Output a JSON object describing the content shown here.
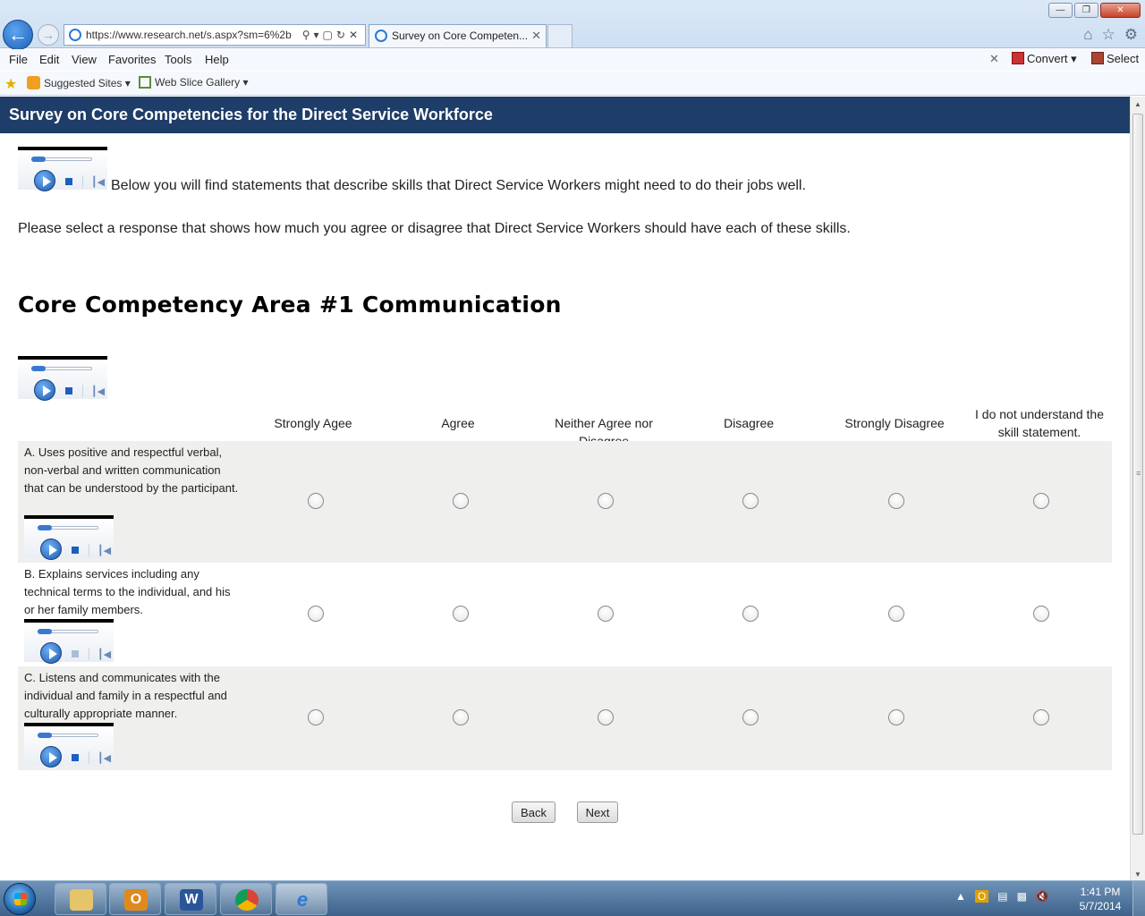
{
  "browser": {
    "address": "https://www.research.net/s.aspx?sm=6%2b",
    "address_host": "research.net",
    "tab_title": "Survey on Core Competen...",
    "menu": [
      "File",
      "Edit",
      "View",
      "Favorites",
      "Tools",
      "Help"
    ],
    "convert_label": "Convert",
    "select_label": "Select",
    "favorites": [
      "Suggested Sites",
      "Web Slice Gallery"
    ]
  },
  "page": {
    "header_title": "Survey on Core Competencies for the Direct Service Workforce",
    "intro": "Below you will find statements that describe skills that Direct Service Workers might need to do their jobs well.",
    "instructions": "Please select a response that shows how much you agree or disagree that Direct Service Workers should have each of these skills.",
    "section_title": "Core Competency Area #1 Communication",
    "columns": [
      "Strongly Agee",
      "Agree",
      "Neither Agree nor Disagree",
      "Disagree",
      "Strongly Disagree",
      "I do not understand the skill statement."
    ],
    "questions": [
      "A. Uses positive and respectful verbal, non-verbal and written communication that can be understood by the participant.",
      "B. Explains services including any technical terms to the individual, and his or her family members.",
      "C. Listens and communicates with the individual and family in a respectful and culturally appropriate manner."
    ],
    "back_label": "Back",
    "next_label": "Next"
  },
  "taskbar": {
    "time": "1:41 PM",
    "date": "5/7/2014"
  },
  "colors": {
    "header_bg": "#1e3d68",
    "row_shade": "#efefed"
  }
}
